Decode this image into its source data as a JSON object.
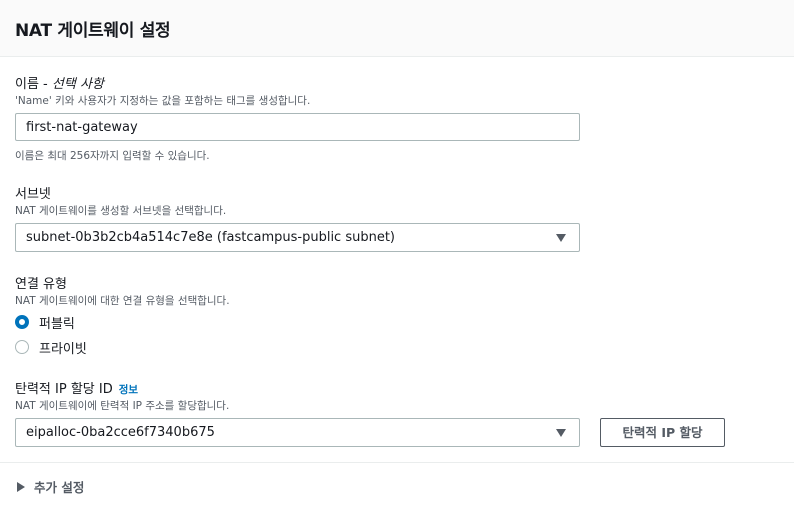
{
  "header": {
    "title": "NAT 게이트웨이 설정"
  },
  "name": {
    "label": "이름 - ",
    "label_optional": "선택 사항",
    "description": "'Name' 키와 사용자가 지정하는 값을 포함하는 태그를 생성합니다.",
    "value": "first-nat-gateway",
    "hint": "이름은 최대 256자까지 입력할 수 있습니다."
  },
  "subnet": {
    "label": "서브넷",
    "description": "NAT 게이트웨이를 생성할 서브넷을 선택합니다.",
    "selected": "subnet-0b3b2cb4a514c7e8e (fastcampus-public subnet)"
  },
  "connectivity": {
    "label": "연결 유형",
    "description": "NAT 게이트웨이에 대한 연결 유형을 선택합니다.",
    "options": [
      {
        "label": "퍼블릭",
        "selected": true
      },
      {
        "label": "프라이빗",
        "selected": false
      }
    ]
  },
  "elastic_ip": {
    "label": "탄력적 IP 할당 ID",
    "info_link": "정보",
    "description": "NAT 게이트웨이에 탄력적 IP 주소를 할당합니다.",
    "selected": "eipalloc-0ba2cce6f7340b675",
    "allocate_button": "탄력적 IP 할당"
  },
  "additional": {
    "label": "추가 설정"
  }
}
